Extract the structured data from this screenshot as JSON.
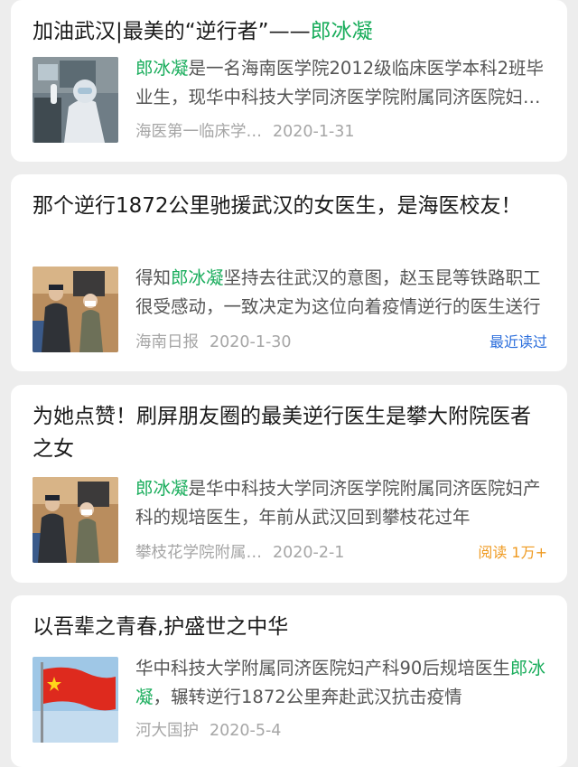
{
  "accent": "#1aad5c",
  "articles": [
    {
      "title_pre": "加油武汉|最美的“逆行者”——",
      "title_hl": "郎冰凝",
      "snippet_pre": "",
      "snippet_hl": "郎冰凝",
      "snippet_post": "是一名海南医学院2012级临床医学本科2班毕业生，现华中科技大学同济医学院附属同济医院妇产科",
      "source": "海医第一临床学…",
      "date": "2020-1-31",
      "badge": ""
    },
    {
      "title_pre": "那个逆行1872公里驰援武汉的女医生，是海医校友！",
      "title_hl": "",
      "snippet_pre": "得知",
      "snippet_hl": "郎冰凝",
      "snippet_post": "坚持去往武汉的意图，赵玉昆等铁路职工很受感动，一致决定为这位向着疫情逆行的医生送行",
      "source": "海南日报",
      "date": "2020-1-30",
      "badge": "最近读过"
    },
    {
      "title_pre": "为她点赞！刷屏朋友圈的最美逆行医生是攀大附院医者之女",
      "title_hl": "",
      "snippet_pre": "",
      "snippet_hl": "郎冰凝",
      "snippet_post": "是华中科技大学同济医学院附属同济医院妇产科的规培医生，年前从武汉回到攀枝花过年",
      "source": "攀枝花学院附属…",
      "date": "2020-2-1",
      "badge": "阅读 1万+"
    },
    {
      "title_pre": "以吾辈之青春,护盛世之中华",
      "title_hl": "",
      "snippet_pre": "华中科技大学附属同济医院妇产科90后规培医生",
      "snippet_hl": "郎冰凝",
      "snippet_post": "，辗转逆行1872公里奔赴武汉抗击疫情",
      "source": "河大国护",
      "date": "2020-5-4",
      "badge": ""
    }
  ]
}
